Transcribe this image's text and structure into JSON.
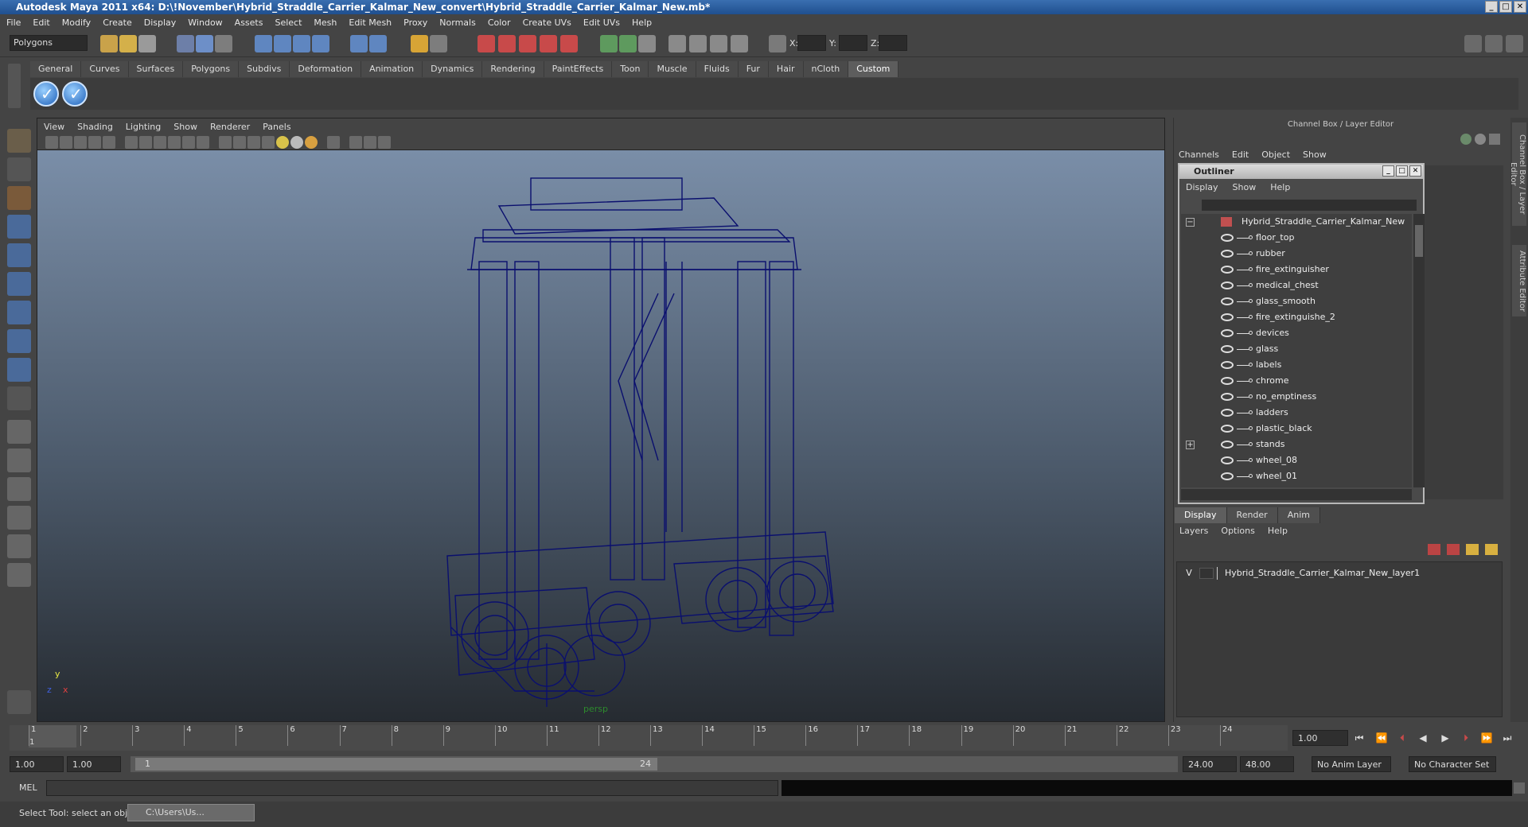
{
  "window": {
    "title": "Autodesk Maya 2011 x64: D:\\!November\\Hybrid_Straddle_Carrier_Kalmar_New_convert\\Hybrid_Straddle_Carrier_Kalmar_New.mb*",
    "min": "_",
    "max": "□",
    "close": "✕"
  },
  "menubar": [
    "File",
    "Edit",
    "Modify",
    "Create",
    "Display",
    "Window",
    "Assets",
    "Select",
    "Mesh",
    "Edit Mesh",
    "Proxy",
    "Normals",
    "Color",
    "Create UVs",
    "Edit UVs",
    "Help"
  ],
  "statusline": {
    "mode": "Polygons",
    "x_label": "X:",
    "y_label": "Y:",
    "z_label": "Z:"
  },
  "shelf": {
    "tabs": [
      "General",
      "Curves",
      "Surfaces",
      "Polygons",
      "Subdivs",
      "Deformation",
      "Animation",
      "Dynamics",
      "Rendering",
      "PaintEffects",
      "Toon",
      "Muscle",
      "Fluids",
      "Fur",
      "Hair",
      "nCloth",
      "Custom"
    ],
    "active": "Custom"
  },
  "viewport": {
    "menu": [
      "View",
      "Shading",
      "Lighting",
      "Show",
      "Renderer",
      "Panels"
    ],
    "camera": "persp",
    "axis_y": "y",
    "axis_x": "x",
    "axis_z": "z",
    "wire_color": "#0a0f6e"
  },
  "channelbox": {
    "header": "Channel Box / Layer Editor",
    "menu": [
      "Channels",
      "Edit",
      "Object",
      "Show"
    ]
  },
  "sidetabs": [
    "Channel Box / Layer Editor",
    "Attribute Editor"
  ],
  "outliner": {
    "title": "Outliner",
    "menu": [
      "Display",
      "Show",
      "Help"
    ],
    "root": "Hybrid_Straddle_Carrier_Kalmar_New",
    "items": [
      "floor_top",
      "rubber",
      "fire_extinguisher",
      "medical_chest",
      "glass_smooth",
      "fire_extinguishe_2",
      "devices",
      "glass",
      "labels",
      "chrome",
      "no_emptiness",
      "ladders",
      "plastic_black",
      "stands",
      "wheel_08",
      "wheel_01"
    ]
  },
  "layers": {
    "tabs": [
      "Display",
      "Render",
      "Anim"
    ],
    "active": "Display",
    "menu": [
      "Layers",
      "Options",
      "Help"
    ],
    "visible_flag": "V",
    "layer_name": "Hybrid_Straddle_Carrier_Kalmar_New_layer1"
  },
  "timeline": {
    "ticks": [
      "1",
      "2",
      "3",
      "4",
      "5",
      "6",
      "7",
      "8",
      "9",
      "10",
      "11",
      "12",
      "13",
      "14",
      "15",
      "16",
      "17",
      "18",
      "19",
      "20",
      "21",
      "22",
      "23",
      "24"
    ],
    "current_frame": "1.00",
    "current_marker": "1"
  },
  "range": {
    "start": "1.00",
    "anim_start": "1.00",
    "range_start": "1",
    "range_end": "24",
    "end": "24.00",
    "anim_end": "48.00",
    "anim_layer": "No Anim Layer",
    "char_set": "No Character Set"
  },
  "cmd": {
    "label": "MEL"
  },
  "help": {
    "text": "Select Tool: select an object",
    "taskbar_label": "C:\\Users\\Us..."
  }
}
